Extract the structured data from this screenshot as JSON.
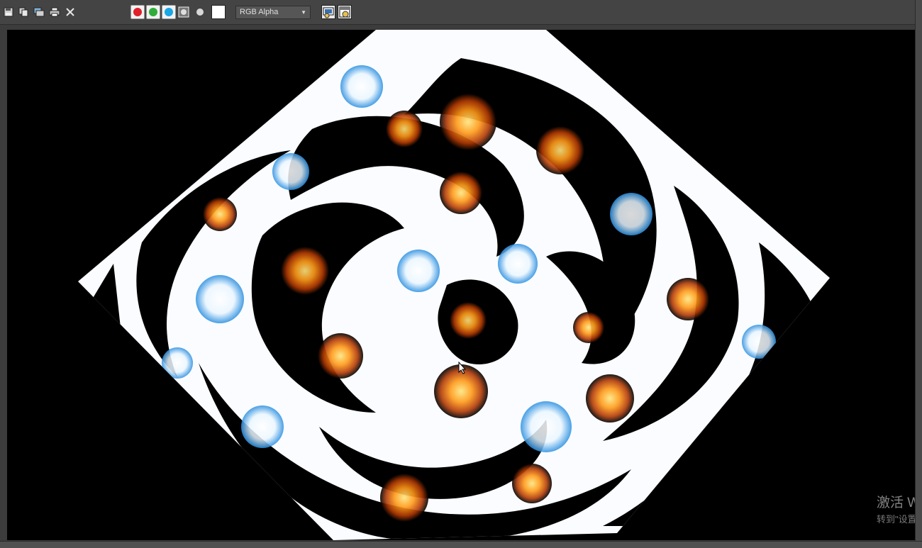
{
  "toolbar": {
    "icons": [
      "save-icon",
      "copy-icon",
      "clone-icon",
      "print-icon",
      "close-icon"
    ],
    "channels": [
      {
        "name": "red-channel",
        "color": "#e0202a"
      },
      {
        "name": "green-channel",
        "color": "#2fae3b"
      },
      {
        "name": "blue-channel",
        "color": "#19a7e6"
      }
    ],
    "display_mode": "RGB Alpha",
    "background_color": "#ffffff"
  },
  "watermark": {
    "line1": "激活 W",
    "line2": "转到\"设置"
  }
}
